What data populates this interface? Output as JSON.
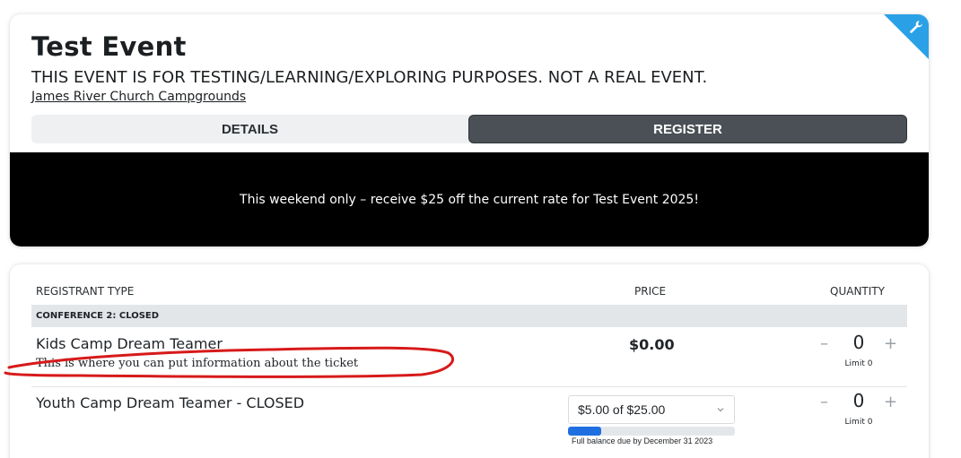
{
  "event": {
    "title": "Test Event",
    "subtitle": "THIS EVENT IS FOR TESTING/LEARNING/EXPLORING PURPOSES. NOT A REAL EVENT.",
    "location": "James River Church Campgrounds",
    "corner_icon": "wrench-icon"
  },
  "tabs": [
    {
      "label": "DETAILS",
      "active": false
    },
    {
      "label": "REGISTER",
      "active": true
    }
  ],
  "promo": {
    "text": "This weekend only – receive $25 off the current rate for Test Event 2025!"
  },
  "registration": {
    "headers": {
      "type": "REGISTRANT TYPE",
      "price": "PRICE",
      "quantity": "QUANTITY"
    },
    "section": "CONFERENCE 2: CLOSED",
    "rows": [
      {
        "name": "Kids Camp Dream Teamer",
        "description": "This is where you can put information about the ticket",
        "price": "$0.00",
        "quantity": "0",
        "limit": "Limit 0",
        "minus": "–",
        "plus": "+"
      },
      {
        "name": "Youth Camp Dream Teamer - CLOSED",
        "price_option": "$5.00 of $25.00",
        "progress_fraction": 0.2,
        "balance_note": "Full balance due by December 31 2023",
        "quantity": "0",
        "limit": "Limit 0",
        "minus": "–",
        "plus": "+"
      }
    ]
  },
  "colors": {
    "accent": "#2aa1e6",
    "active_tab": "#4a5056",
    "progress": "#1f6fe0",
    "annotation": "#d71a1a"
  }
}
